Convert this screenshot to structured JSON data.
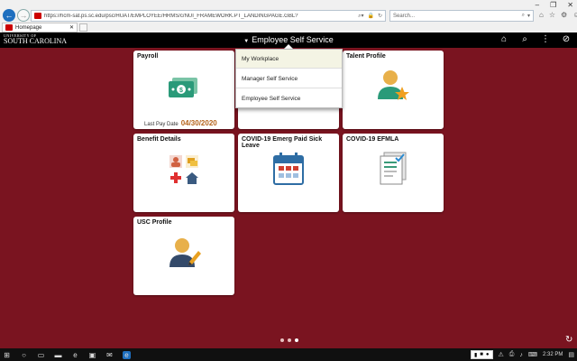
{
  "browser": {
    "url": "https://hcm-sat.ps.sc.edu/psc/HUAT/EMPLOYEE/HRMS/c/NUI_FRAMEWORK.PT_LANDINGPAGE.GBL?",
    "search_placeholder": "Search...",
    "tab_label": "Homepage"
  },
  "header": {
    "logo_top": "UNIVERSITY OF",
    "logo_main": "SOUTH CAROLINA",
    "title": "Employee Self Service"
  },
  "dropdown": {
    "items": [
      {
        "label": "My Workplace"
      },
      {
        "label": "Manager Self Service"
      },
      {
        "label": "Employee Self Service"
      }
    ]
  },
  "tiles": [
    {
      "title": "Payroll",
      "icon": "money-icon",
      "subtitle_label": "Last Pay Date",
      "subtitle_value": "04/30/2020"
    },
    {
      "title": "Talent Profile",
      "icon": "person-star-icon"
    },
    {
      "title": "Benefit Details",
      "icon": "benefits-icon"
    },
    {
      "title": "COVID-19 Emerg Paid Sick Leave",
      "icon": "calendar-icon"
    },
    {
      "title": "COVID-19 EFMLA",
      "icon": "document-check-icon"
    },
    {
      "title": "USC Profile",
      "icon": "person-pencil-icon"
    }
  ],
  "taskbar": {
    "time": "2:32 PM"
  },
  "colors": {
    "background": "#7a1420",
    "header": "#000000",
    "accent_orange": "#b5651d"
  }
}
